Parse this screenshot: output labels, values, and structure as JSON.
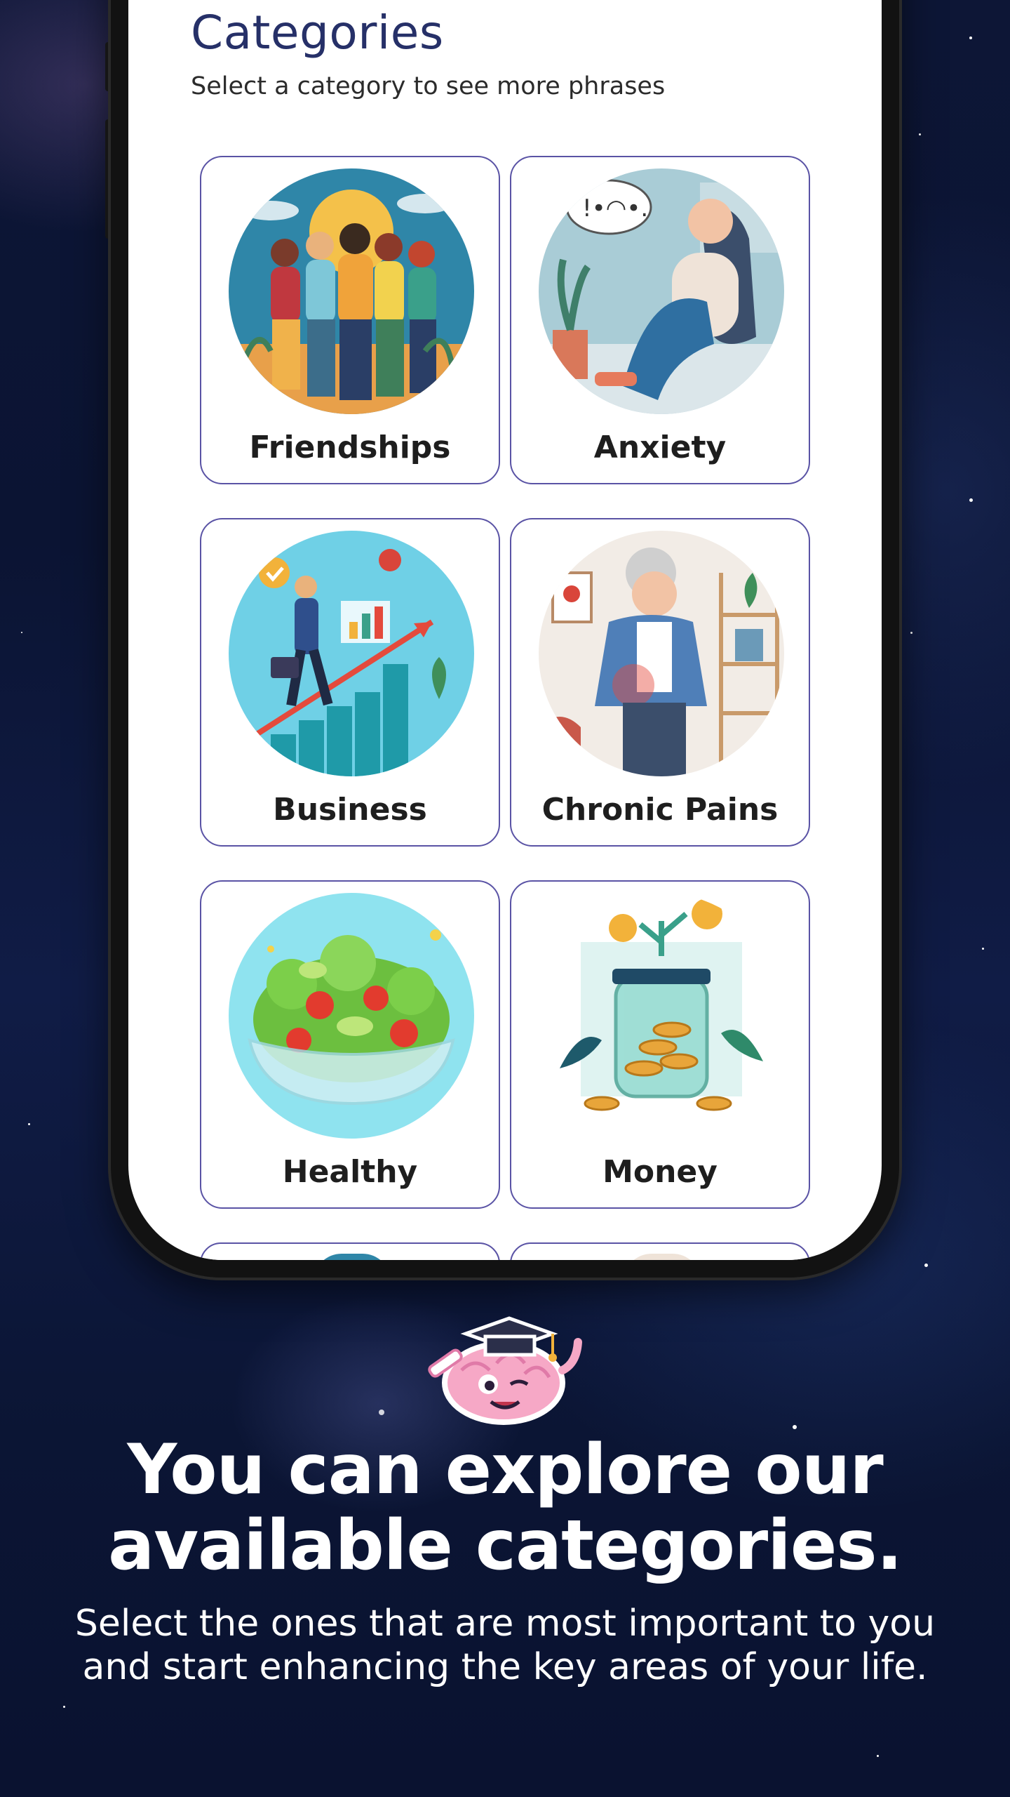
{
  "screen": {
    "title": "Categories",
    "subtitle": "Select a category to see more phrases"
  },
  "categories": [
    {
      "label": "Friendships",
      "icon": "friendships-illustration"
    },
    {
      "label": "Anxiety",
      "icon": "anxiety-illustration"
    },
    {
      "label": "Business",
      "icon": "business-illustration"
    },
    {
      "label": "Chronic Pains",
      "icon": "chronic-pains-illustration"
    },
    {
      "label": "Healthy",
      "icon": "healthy-illustration"
    },
    {
      "label": "Money",
      "icon": "money-illustration"
    }
  ],
  "promo": {
    "headline_line1": "You can explore our",
    "headline_line2": "available categories.",
    "body_line1": "Select the ones that are most important to you",
    "body_line2": "and start enhancing the key areas of your life."
  },
  "colors": {
    "title": "#263068",
    "card_border": "#5a53a5",
    "background": "#0d1636"
  }
}
